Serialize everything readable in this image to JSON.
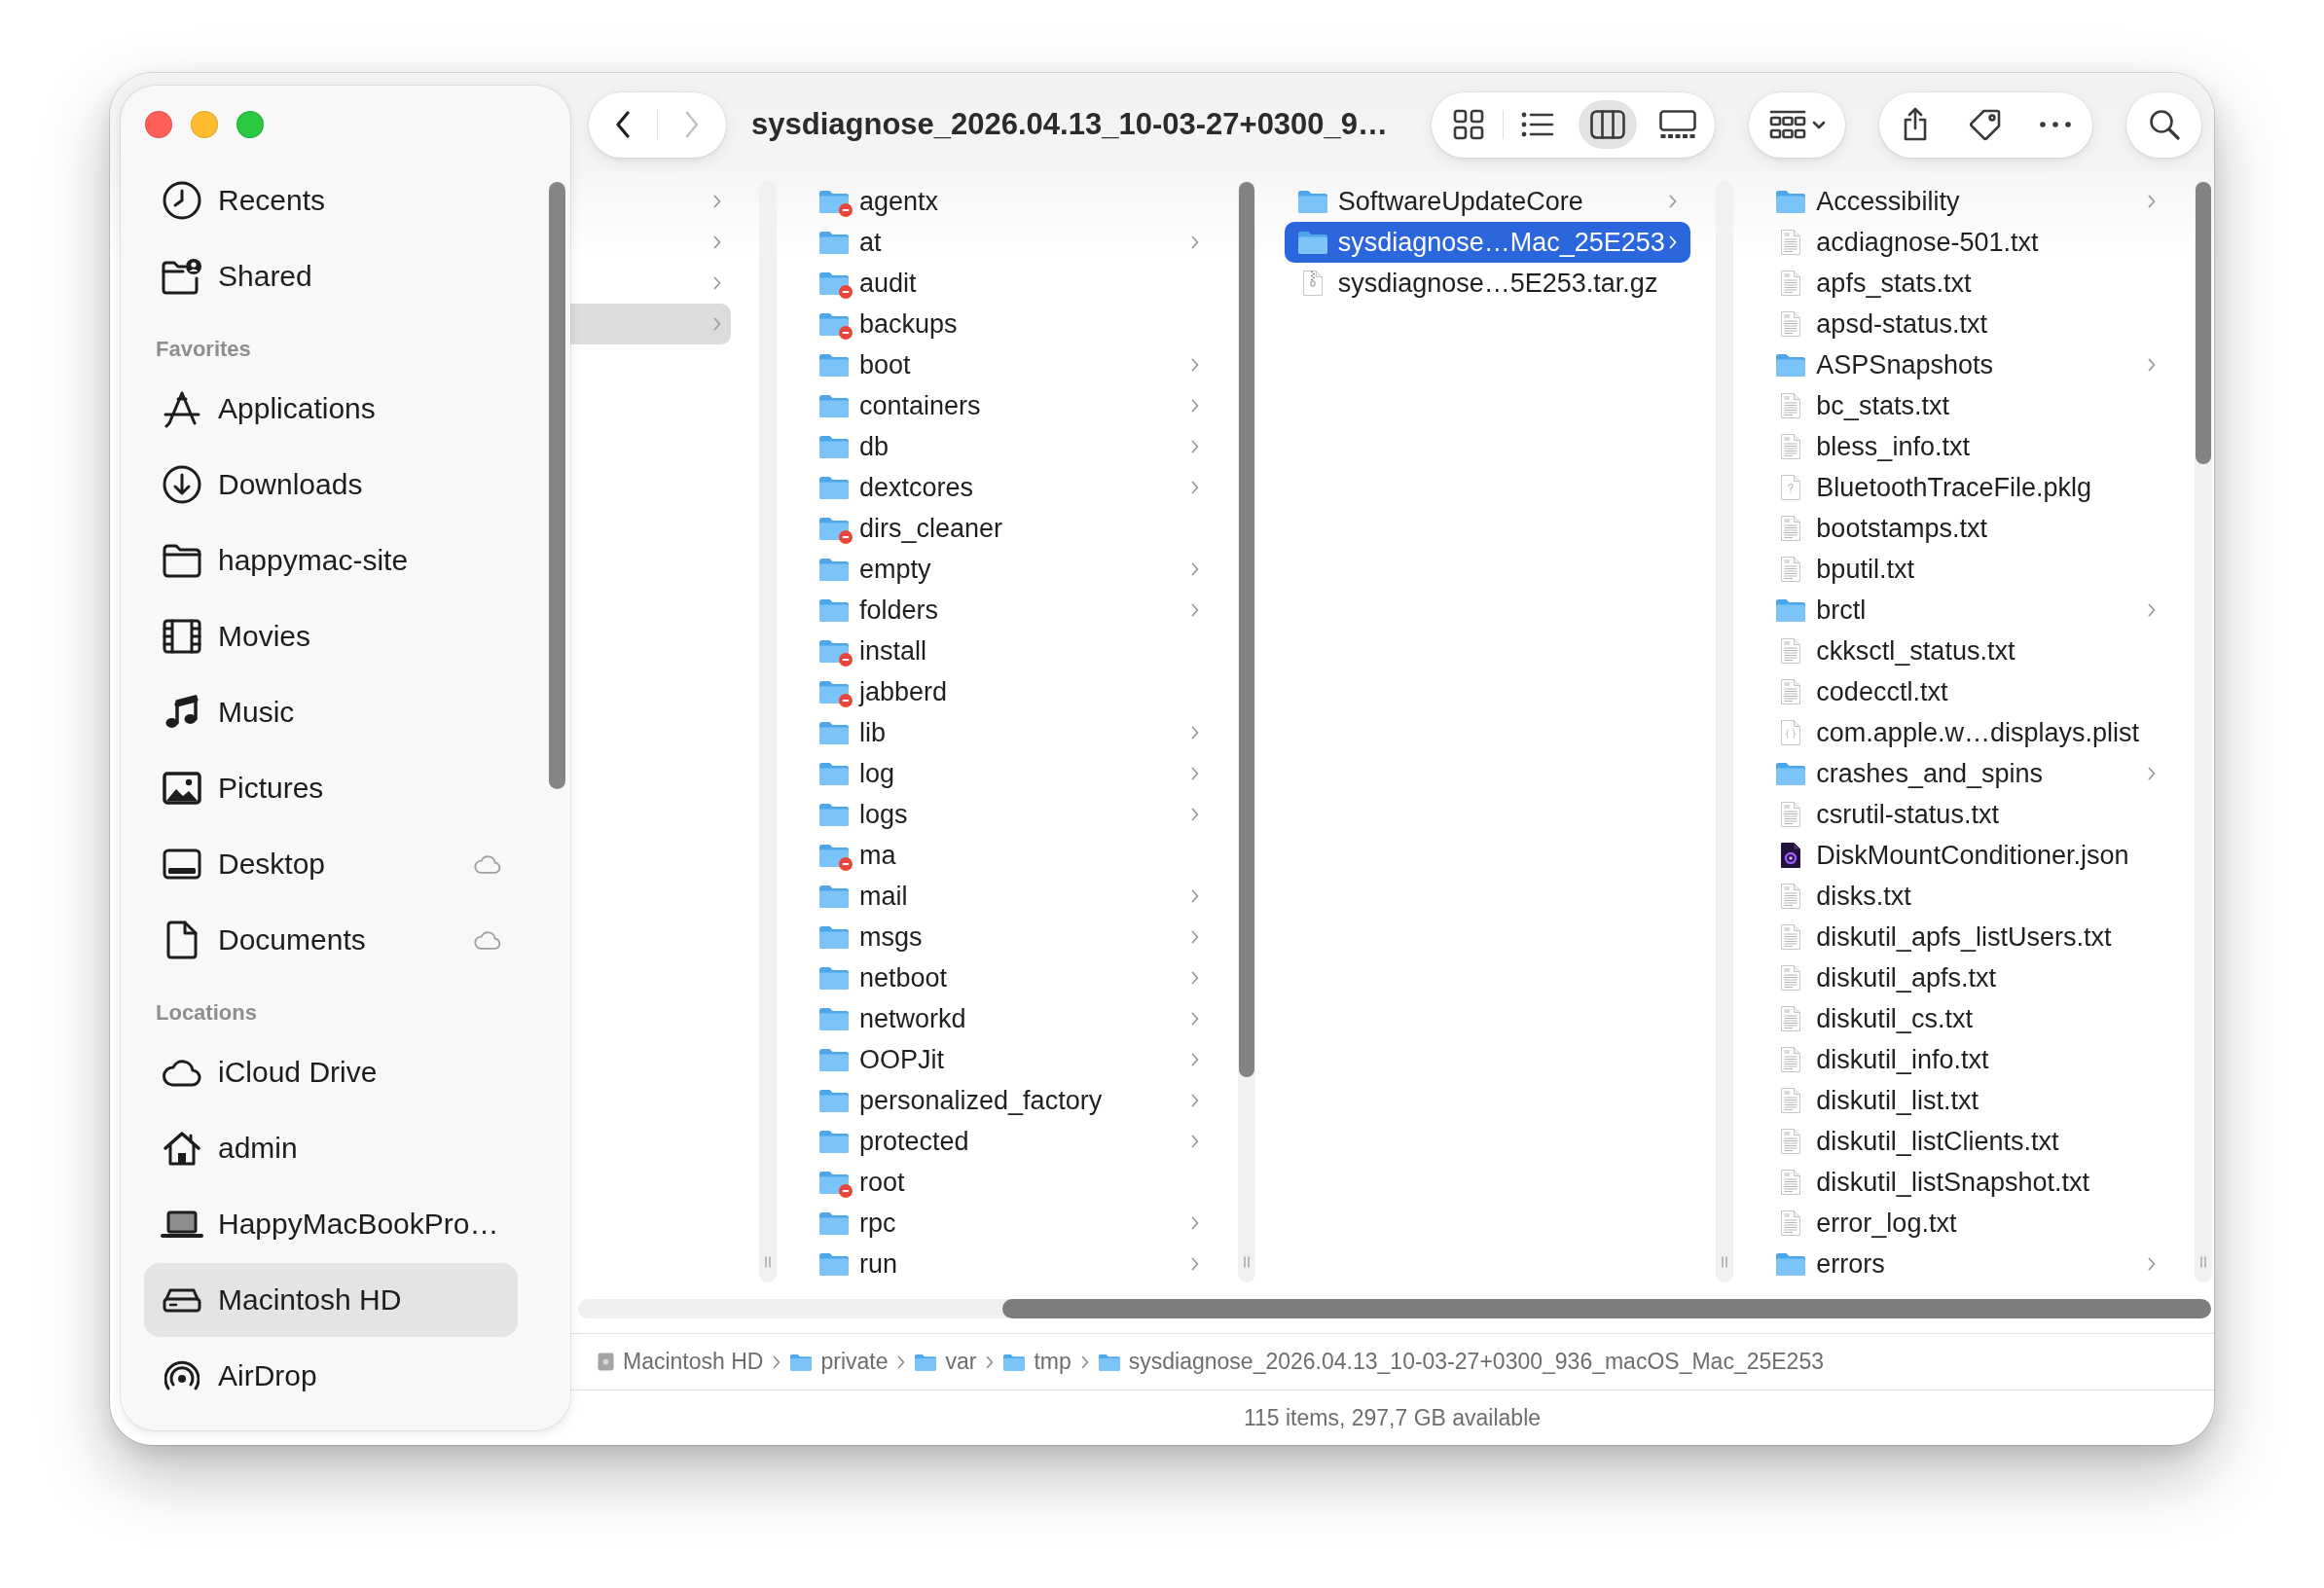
{
  "sidebar": {
    "sections": [
      {
        "items": [
          {
            "label": "Recents",
            "kind": "recents",
            "cloud": false,
            "selected": false
          },
          {
            "label": "Shared",
            "kind": "shared",
            "cloud": false,
            "selected": false
          }
        ]
      },
      {
        "header": "Favorites",
        "items": [
          {
            "label": "Applications",
            "kind": "applications",
            "cloud": false,
            "selected": false
          },
          {
            "label": "Downloads",
            "kind": "downloads",
            "cloud": false,
            "selected": false
          },
          {
            "label": "happymac-site",
            "kind": "folder",
            "cloud": false,
            "selected": false
          },
          {
            "label": "Movies",
            "kind": "movies",
            "cloud": false,
            "selected": false
          },
          {
            "label": "Music",
            "kind": "music",
            "cloud": false,
            "selected": false
          },
          {
            "label": "Pictures",
            "kind": "pictures",
            "cloud": false,
            "selected": false
          },
          {
            "label": "Desktop",
            "kind": "desktop",
            "cloud": true,
            "selected": false
          },
          {
            "label": "Documents",
            "kind": "documents",
            "cloud": true,
            "selected": false
          }
        ]
      },
      {
        "header": "Locations",
        "items": [
          {
            "label": "iCloud Drive",
            "kind": "icloud",
            "cloud": false,
            "selected": false
          },
          {
            "label": "admin",
            "kind": "home",
            "cloud": false,
            "selected": false
          },
          {
            "label": "HappyMacBookPro…",
            "kind": "computer",
            "cloud": false,
            "selected": false
          },
          {
            "label": "Macintosh HD",
            "kind": "disk",
            "cloud": false,
            "selected": true
          },
          {
            "label": "AirDrop",
            "kind": "airdrop",
            "cloud": false,
            "selected": false
          }
        ]
      }
    ]
  },
  "toolbar": {
    "navigation": [
      {
        "kind": "back",
        "disabled": false
      },
      {
        "kind": "forward",
        "disabled": true
      }
    ],
    "title": "sysdiagnose_2026.04.13_10-03-27+0300_9…",
    "view_modes": [
      {
        "kind": "icons",
        "selected": false
      },
      {
        "kind": "list",
        "selected": false
      },
      {
        "kind": "columns",
        "selected": true
      },
      {
        "kind": "gallery",
        "selected": false
      }
    ]
  },
  "columns": [
    {
      "focused": false,
      "rows": [
        {
          "expandable": true,
          "selected": false
        },
        {
          "expandable": true,
          "selected": false
        },
        {
          "expandable": true,
          "selected": false
        },
        {
          "expandable": true,
          "selected": true
        }
      ]
    },
    {
      "rows": [
        {
          "name": "agentx",
          "kind": "folder",
          "restricted": true,
          "expandable": false,
          "selected": false
        },
        {
          "name": "at",
          "kind": "folder",
          "restricted": false,
          "expandable": true,
          "selected": false
        },
        {
          "name": "audit",
          "kind": "folder",
          "restricted": true,
          "expandable": false,
          "selected": false
        },
        {
          "name": "backups",
          "kind": "folder",
          "restricted": true,
          "expandable": false,
          "selected": false
        },
        {
          "name": "boot",
          "kind": "folder",
          "restricted": false,
          "expandable": true,
          "selected": false
        },
        {
          "name": "containers",
          "kind": "folder",
          "restricted": false,
          "expandable": true,
          "selected": false
        },
        {
          "name": "db",
          "kind": "folder",
          "restricted": false,
          "expandable": true,
          "selected": false
        },
        {
          "name": "dextcores",
          "kind": "folder",
          "restricted": false,
          "expandable": true,
          "selected": false
        },
        {
          "name": "dirs_cleaner",
          "kind": "folder",
          "restricted": true,
          "expandable": false,
          "selected": false
        },
        {
          "name": "empty",
          "kind": "folder",
          "restricted": false,
          "expandable": true,
          "selected": false
        },
        {
          "name": "folders",
          "kind": "folder",
          "restricted": false,
          "expandable": true,
          "selected": false
        },
        {
          "name": "install",
          "kind": "folder",
          "restricted": true,
          "expandable": false,
          "selected": false
        },
        {
          "name": "jabberd",
          "kind": "folder",
          "restricted": true,
          "expandable": false,
          "selected": false
        },
        {
          "name": "lib",
          "kind": "folder",
          "restricted": false,
          "expandable": true,
          "selected": false
        },
        {
          "name": "log",
          "kind": "folder",
          "restricted": false,
          "expandable": true,
          "selected": false
        },
        {
          "name": "logs",
          "kind": "folder",
          "restricted": false,
          "expandable": true,
          "selected": false
        },
        {
          "name": "ma",
          "kind": "folder",
          "restricted": true,
          "expandable": false,
          "selected": false
        },
        {
          "name": "mail",
          "kind": "folder",
          "restricted": false,
          "expandable": true,
          "selected": false
        },
        {
          "name": "msgs",
          "kind": "folder",
          "restricted": false,
          "expandable": true,
          "selected": false
        },
        {
          "name": "netboot",
          "kind": "folder",
          "restricted": false,
          "expandable": true,
          "selected": false
        },
        {
          "name": "networkd",
          "kind": "folder",
          "restricted": false,
          "expandable": true,
          "selected": false
        },
        {
          "name": "OOPJit",
          "kind": "folder",
          "restricted": false,
          "expandable": true,
          "selected": false
        },
        {
          "name": "personalized_factory",
          "kind": "folder",
          "restricted": false,
          "expandable": true,
          "selected": false
        },
        {
          "name": "protected",
          "kind": "folder",
          "restricted": false,
          "expandable": true,
          "selected": false
        },
        {
          "name": "root",
          "kind": "folder",
          "restricted": true,
          "expandable": false,
          "selected": false
        },
        {
          "name": "rpc",
          "kind": "folder",
          "restricted": false,
          "expandable": true,
          "selected": false
        },
        {
          "name": "run",
          "kind": "folder",
          "restricted": false,
          "expandable": true,
          "selected": false
        }
      ]
    },
    {
      "focused": true,
      "rows": [
        {
          "name": "SoftwareUpdateCore",
          "kind": "folder",
          "expandable": true,
          "selected": false
        },
        {
          "name": "sysdiagnose…Mac_25E253",
          "kind": "folder",
          "expandable": true,
          "selected": true
        },
        {
          "name": "sysdiagnose…5E253.tar.gz",
          "kind": "archive",
          "expandable": false,
          "selected": false
        }
      ]
    },
    {
      "rows": [
        {
          "name": "Accessibility",
          "kind": "folder",
          "expandable": true,
          "selected": false
        },
        {
          "name": "acdiagnose-501.txt",
          "kind": "text",
          "expandable": false,
          "selected": false
        },
        {
          "name": "apfs_stats.txt",
          "kind": "text",
          "expandable": false,
          "selected": false
        },
        {
          "name": "apsd-status.txt",
          "kind": "text",
          "expandable": false,
          "selected": false
        },
        {
          "name": "ASPSnapshots",
          "kind": "folder",
          "expandable": true,
          "selected": false
        },
        {
          "name": "bc_stats.txt",
          "kind": "text",
          "expandable": false,
          "selected": false
        },
        {
          "name": "bless_info.txt",
          "kind": "text",
          "expandable": false,
          "selected": false
        },
        {
          "name": "BluetoothTraceFile.pklg",
          "kind": "document",
          "expandable": false,
          "selected": false
        },
        {
          "name": "bootstamps.txt",
          "kind": "text",
          "expandable": false,
          "selected": false
        },
        {
          "name": "bputil.txt",
          "kind": "text",
          "expandable": false,
          "selected": false
        },
        {
          "name": "brctl",
          "kind": "folder",
          "expandable": true,
          "selected": false
        },
        {
          "name": "ckksctl_status.txt",
          "kind": "text",
          "expandable": false,
          "selected": false
        },
        {
          "name": "codecctl.txt",
          "kind": "text",
          "expandable": false,
          "selected": false
        },
        {
          "name": "com.apple.w…displays.plist",
          "kind": "plist",
          "expandable": false,
          "selected": false
        },
        {
          "name": "crashes_and_spins",
          "kind": "folder",
          "expandable": true,
          "selected": false
        },
        {
          "name": "csrutil-status.txt",
          "kind": "text",
          "expandable": false,
          "selected": false
        },
        {
          "name": "DiskMountConditioner.json",
          "kind": "json",
          "expandable": false,
          "selected": false
        },
        {
          "name": "disks.txt",
          "kind": "text",
          "expandable": false,
          "selected": false
        },
        {
          "name": "diskutil_apfs_listUsers.txt",
          "kind": "text",
          "expandable": false,
          "selected": false
        },
        {
          "name": "diskutil_apfs.txt",
          "kind": "text",
          "expandable": false,
          "selected": false
        },
        {
          "name": "diskutil_cs.txt",
          "kind": "text",
          "expandable": false,
          "selected": false
        },
        {
          "name": "diskutil_info.txt",
          "kind": "text",
          "expandable": false,
          "selected": false
        },
        {
          "name": "diskutil_list.txt",
          "kind": "text",
          "expandable": false,
          "selected": false
        },
        {
          "name": "diskutil_listClients.txt",
          "kind": "text",
          "expandable": false,
          "selected": false
        },
        {
          "name": "diskutil_listSnapshot.txt",
          "kind": "text",
          "expandable": false,
          "selected": false
        },
        {
          "name": "error_log.txt",
          "kind": "text",
          "expandable": false,
          "selected": false
        },
        {
          "name": "errors",
          "kind": "folder",
          "expandable": true,
          "selected": false
        }
      ]
    }
  ],
  "path_bar": [
    {
      "kind": "disk",
      "name": "Macintosh HD"
    },
    {
      "kind": "folder",
      "name": "private"
    },
    {
      "kind": "folder",
      "name": "var"
    },
    {
      "kind": "folder",
      "name": "tmp"
    },
    {
      "kind": "folder",
      "name": "sysdiagnose_2026.04.13_10-03-27+0300_936_macOS_Mac_25E253"
    }
  ],
  "status_bar": {
    "text": "115 items, 297,7 GB available"
  }
}
